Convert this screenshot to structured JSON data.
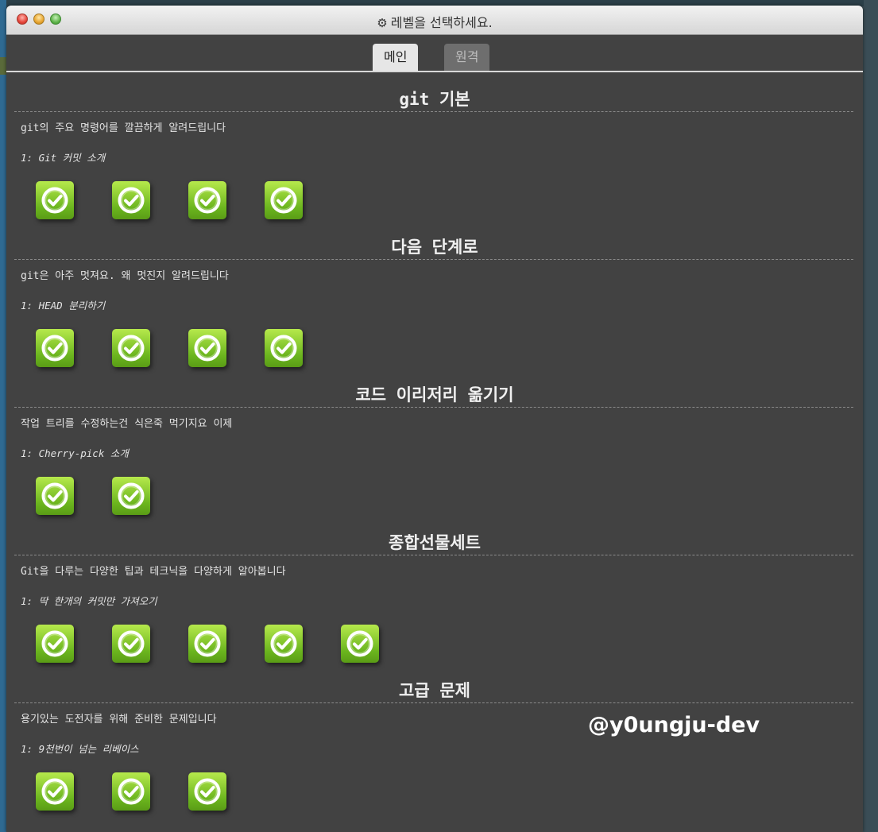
{
  "window": {
    "title": "레벨을 선택하세요.",
    "title_icon": "gear-icon"
  },
  "tabs": [
    {
      "label": "메인",
      "active": true
    },
    {
      "label": "원격",
      "active": false
    }
  ],
  "sections": [
    {
      "title": "git 기본",
      "description": "git의 주요 명령어를 깔끔하게 알려드립니다",
      "subtitle": "1: Git 커밋 소개",
      "level_count": 4
    },
    {
      "title": "다음 단계로",
      "description": "git은 아주 멋져요. 왜 멋진지 알려드립니다",
      "subtitle": "1: HEAD 분리하기",
      "level_count": 4
    },
    {
      "title": "코드 이리저리 옮기기",
      "description": "작업 트리를 수정하는건 식은죽 먹기지요 이제",
      "subtitle": "1: Cherry-pick 소개",
      "level_count": 2
    },
    {
      "title": "종합선물세트",
      "description": "Git을 다루는 다양한 팁과 테크닉을 다양하게 알아봅니다",
      "subtitle": "1: 딱 한개의 커밋만 가져오기",
      "level_count": 5
    },
    {
      "title": "고급 문제",
      "description": "용기있는 도전자를 위해 준비한 문제입니다",
      "subtitle": "1: 9천번이 넘는 리베이스",
      "level_count": 3
    }
  ],
  "level_icon": "check-circle-icon",
  "level_status": "completed",
  "colors": {
    "panel_bg": "#424242",
    "level_green_top": "#b6e94c",
    "level_green_bottom": "#6bb51e",
    "active_tab_bg": "#e6e6e6",
    "inactive_tab_bg": "#6e6e6e"
  },
  "watermark": "@y0ungju-dev"
}
